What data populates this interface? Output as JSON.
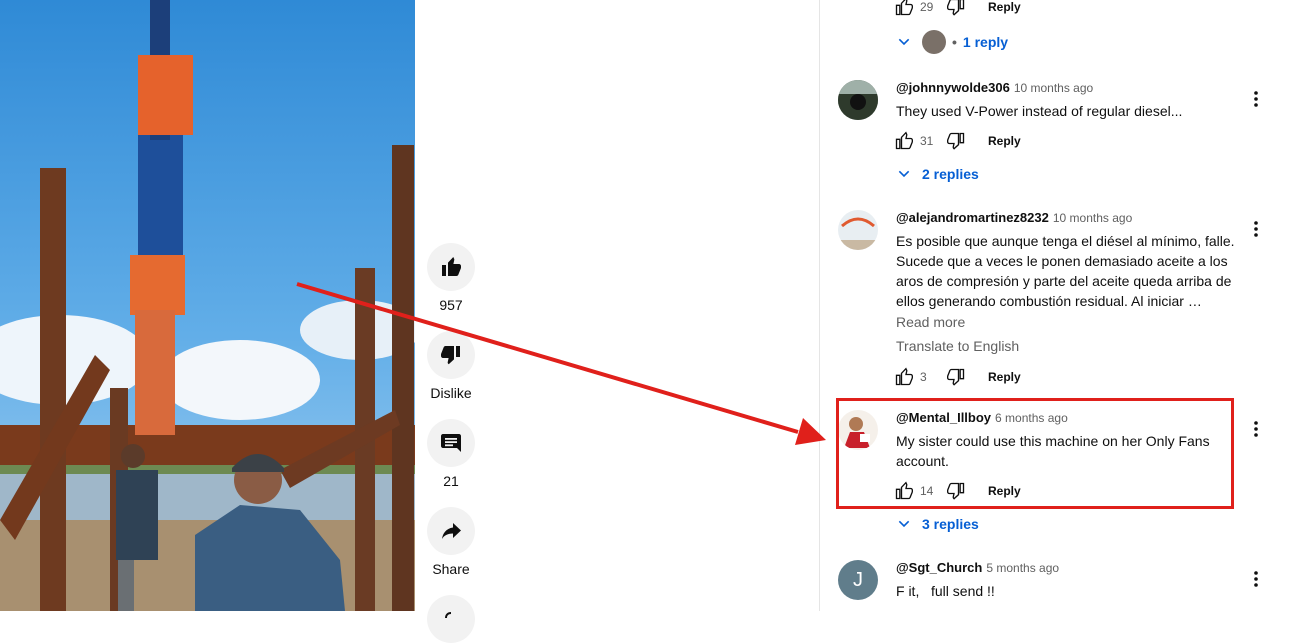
{
  "video": {
    "description_icons": [
      "pile-driver-scene"
    ]
  },
  "actions": {
    "like_count": "957",
    "dislike_label": "Dislike",
    "comment_count": "21",
    "share_label": "Share"
  },
  "comments": [
    {
      "like_count": "29",
      "reply_label": "Reply",
      "replies_label": "1 reply",
      "replies_prefix": "•"
    },
    {
      "author": "@johnnywolde306",
      "time": "10 months ago",
      "text": "They used V-Power instead of regular diesel...",
      "like_count": "31",
      "reply_label": "Reply",
      "replies_label": "2 replies"
    },
    {
      "author": "@alejandromartinez8232",
      "time": "10 months ago",
      "text": "Es posible que aunque tenga el diésel al mínimo, falle. Sucede que a veces le ponen demasiado aceite a los aros de compresión y parte del aceite queda arriba de ellos generando combustión residual. Al iniciar …",
      "read_more": "Read more",
      "translate": "Translate to English",
      "like_count": "3",
      "reply_label": "Reply"
    },
    {
      "author": "@Mental_Illboy",
      "time": "6 months ago",
      "text": "My sister could use this machine on her Only Fans account.",
      "like_count": "14",
      "reply_label": "Reply",
      "replies_label": "3 replies"
    },
    {
      "author": "@Sgt_Church",
      "time": "5 months ago",
      "text": "F it,   full send !!",
      "avatar_letter": "J"
    }
  ],
  "colors": {
    "reply_link": "#065fd4",
    "highlight": "#e0201b",
    "avatar_j": "#607d8b"
  }
}
